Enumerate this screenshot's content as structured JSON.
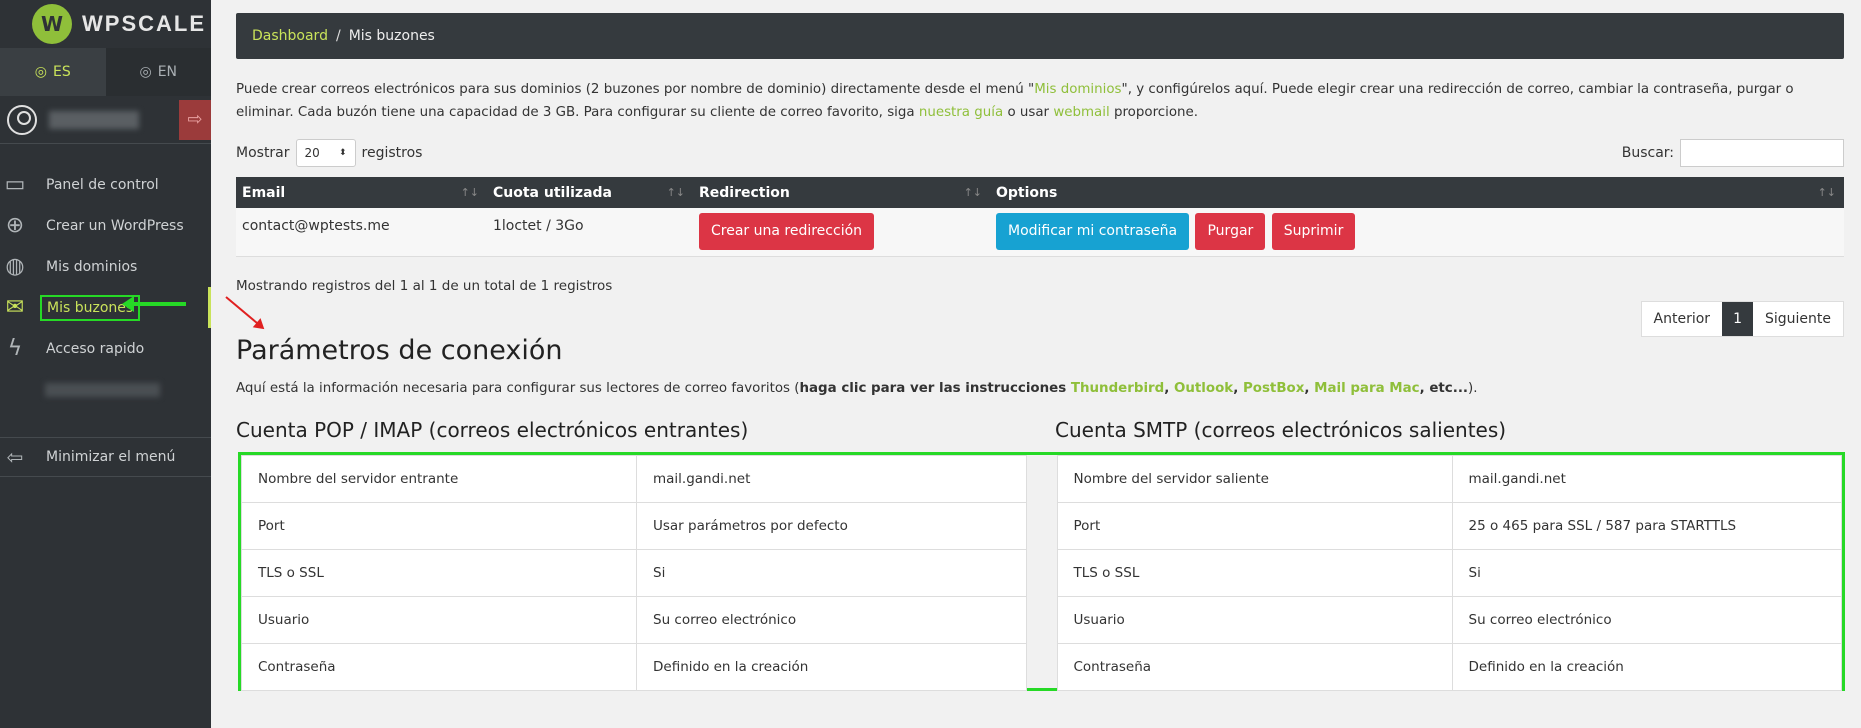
{
  "sidebar": {
    "logo_text": "WPSCALE",
    "lang_es": "ES",
    "lang_en": "EN",
    "items": [
      {
        "label": "Panel de control",
        "icon": "monitor-icon"
      },
      {
        "label": "Crear un WordPress",
        "icon": "plus-circle-icon"
      },
      {
        "label": "Mis dominios",
        "icon": "globe-icon"
      },
      {
        "label": "Mis buzones",
        "icon": "envelope-icon"
      },
      {
        "label": "Acceso rapido",
        "icon": "bolt-icon"
      }
    ],
    "minimize_label": "Minimizar el menú"
  },
  "breadcrumb": {
    "home": "Dashboard",
    "separator": "/",
    "current": "Mis buzones"
  },
  "intro": {
    "part1": "Puede crear correos electrónicos para sus dominios (2 buzones por nombre de dominio) directamente desde el menú \"",
    "link1": "Mis dominios",
    "part2": "\", y configúrelos aquí. Puede elegir crear una redirección de correo, cambiar la contraseña, purgar o eliminar. Cada buzón tiene una capacidad de 3 GB. Para configurar su cliente de correo favorito, siga ",
    "link2": "nuestra guía",
    "part3": " o usar ",
    "link3": "webmail",
    "part4": " proporcione."
  },
  "table_controls": {
    "show_label": "Mostrar",
    "length_value": "20",
    "records_label": "registros",
    "search_label": "Buscar:"
  },
  "mail_table": {
    "headers": [
      "Email",
      "Cuota utilizada",
      "Redirection",
      "Options"
    ],
    "rows": [
      {
        "email": "contact@wptests.me",
        "quota": "1loctet / 3Go",
        "redirect_button": "Crear una redirección",
        "modify_button": "Modificar mi contraseña",
        "purge_button": "Purgar",
        "delete_button": "Suprimir"
      }
    ]
  },
  "table_info": "Mostrando registros del 1 al 1 de un total de 1 registros",
  "pagination": {
    "prev": "Anterior",
    "page": "1",
    "next": "Siguiente"
  },
  "connection": {
    "title": "Parámetros de conexión",
    "desc_part1": "Aquí está la información necesaria para configurar sus lectores de correo favoritos (",
    "desc_bold": "haga clic para ver las instrucciones ",
    "client_links": [
      "Thunderbird",
      "Outlook",
      "PostBox",
      "Mail para Mac"
    ],
    "desc_end": ", etc...",
    "desc_close": ").",
    "pop_title": "Cuenta POP / IMAP (correos electrónicos entrantes)",
    "smtp_title": "Cuenta SMTP (correos electrónicos salientes)",
    "pop_rows": [
      {
        "key": "Nombre del servidor entrante",
        "value": "mail.gandi.net"
      },
      {
        "key": "Port",
        "value": "Usar parámetros por defecto"
      },
      {
        "key": "TLS o SSL",
        "value": "Si"
      },
      {
        "key": "Usuario",
        "value": "Su correo electrónico"
      },
      {
        "key": "Contraseña",
        "value": "Definido en la creación"
      }
    ],
    "smtp_rows": [
      {
        "key": "Nombre del servidor saliente",
        "value": "mail.gandi.net"
      },
      {
        "key": "Port",
        "value": "25 o 465 para SSL / 587 para STARTTLS"
      },
      {
        "key": "TLS o SSL",
        "value": "Si"
      },
      {
        "key": "Usuario",
        "value": "Su correo electrónico"
      },
      {
        "key": "Contraseña",
        "value": "Definido en la creación"
      }
    ]
  },
  "colors": {
    "accent": "#c9e35a",
    "link": "#8fbf3a",
    "danger": "#dc3545",
    "info": "#17a2d2",
    "highlight": "#26d926",
    "sidebar_bg": "#2e3236"
  }
}
